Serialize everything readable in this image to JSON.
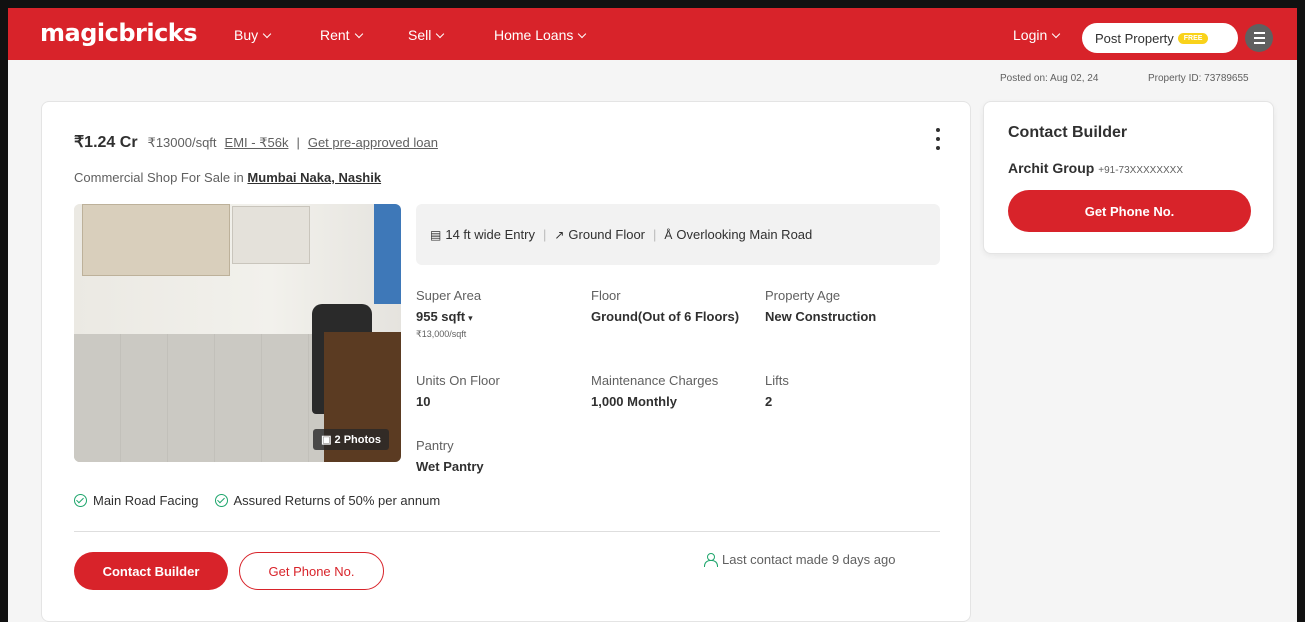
{
  "header": {
    "logo": "magicbricks",
    "nav": [
      {
        "label": "Buy"
      },
      {
        "label": "Rent"
      },
      {
        "label": "Sell"
      },
      {
        "label": "Home Loans"
      }
    ],
    "login_label": "Login",
    "post_property_label": "Post Property",
    "free_badge": "FREE"
  },
  "meta": {
    "posted_on": "Posted on: Aug 02, 24",
    "property_id": "Property ID: 73789655"
  },
  "listing": {
    "price": "₹1.24 Cr",
    "price_per_sqft": "₹13000/sqft",
    "emi": "EMI - ₹56k",
    "separator": "|",
    "preapproved_link": "Get pre-approved loan",
    "title_prefix": "Commercial Shop For Sale in",
    "location": "Mumbai Naka, Nashik",
    "photos_label": "2 Photos",
    "features": [
      {
        "label": "14 ft wide Entry",
        "icon": "entry-icon"
      },
      {
        "label": "Ground Floor",
        "icon": "stairs-icon"
      },
      {
        "label": "Overlooking Main Road",
        "icon": "road-icon"
      }
    ],
    "specs": {
      "super_area": {
        "label": "Super Area",
        "value": "955 sqft",
        "sub": "₹13,000/sqft"
      },
      "floor": {
        "label": "Floor",
        "value": "Ground(Out of 6 Floors)"
      },
      "property_age": {
        "label": "Property Age",
        "value": "New Construction"
      },
      "units_on_floor": {
        "label": "Units On Floor",
        "value": "10"
      },
      "maintenance": {
        "label": "Maintenance Charges",
        "value": "1,000 Monthly"
      },
      "lifts": {
        "label": "Lifts",
        "value": "2"
      },
      "pantry": {
        "label": "Pantry",
        "value": "Wet Pantry"
      }
    },
    "tags": [
      "Main Road Facing",
      "Assured Returns of 50% per annum"
    ],
    "contact_button": "Contact Builder",
    "phone_button": "Get Phone No.",
    "last_contact": "Last contact made 9 days ago"
  },
  "sidebar": {
    "title": "Contact Builder",
    "builder_name": "Archit Group",
    "builder_phone": "+91-73XXXXXXXX",
    "phone_button": "Get Phone No."
  },
  "colors": {
    "brand_red": "#d8232a",
    "success_green": "#1da56b",
    "free_yellow": "#f9d21a"
  }
}
